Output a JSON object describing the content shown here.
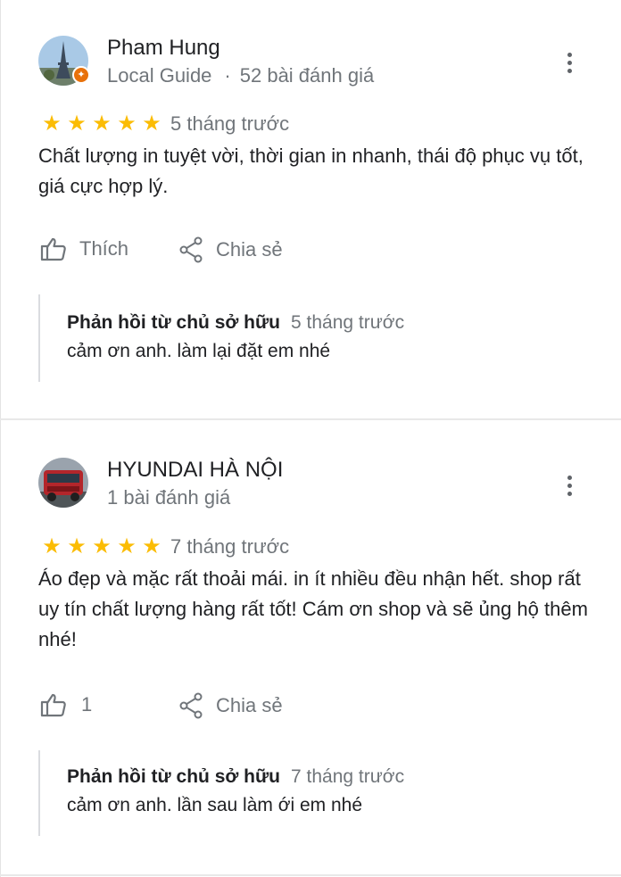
{
  "reviews": [
    {
      "author": "Pham Hung",
      "badge": "Local Guide",
      "review_count": "52 bài đánh giá",
      "stars": 5,
      "time": "5 tháng trước",
      "text": "Chất lượng in tuyệt vời, thời gian in nhanh, thái độ phục vụ tốt, giá cực hợp lý.",
      "like_label": "Thích",
      "share_label": "Chia sẻ",
      "reply": {
        "owner_label": "Phản hồi từ chủ sở hữu",
        "time": "5 tháng trước",
        "text": "cảm ơn anh. làm lại đặt em nhé"
      },
      "icons": {
        "like": "thumbs-up-icon",
        "share": "share-icon",
        "menu": "more-vert-icon"
      }
    },
    {
      "author": "HYUNDAI HÀ NỘI",
      "review_count": "1 bài đánh giá",
      "stars": 5,
      "time": "7 tháng trước",
      "text": "Áo đẹp và mặc rất thoải mái. in ít nhiều đều nhận hết. shop rất uy tín chất lượng hàng rất tốt! Cám ơn shop và sẽ ủng hộ thêm nhé!",
      "like_count": "1",
      "share_label": "Chia sẻ",
      "reply": {
        "owner_label": "Phản hồi từ chủ sở hữu",
        "time": "7 tháng trước",
        "text": "cảm ơn anh. lần sau làm ới em nhé"
      },
      "icons": {
        "like": "thumbs-up-icon",
        "share": "share-icon",
        "menu": "more-vert-icon"
      }
    }
  ],
  "colors": {
    "star": "#fbbc04",
    "secondary_text": "#70757a",
    "primary_text": "#202124",
    "guide_badge": "#e8710a"
  }
}
